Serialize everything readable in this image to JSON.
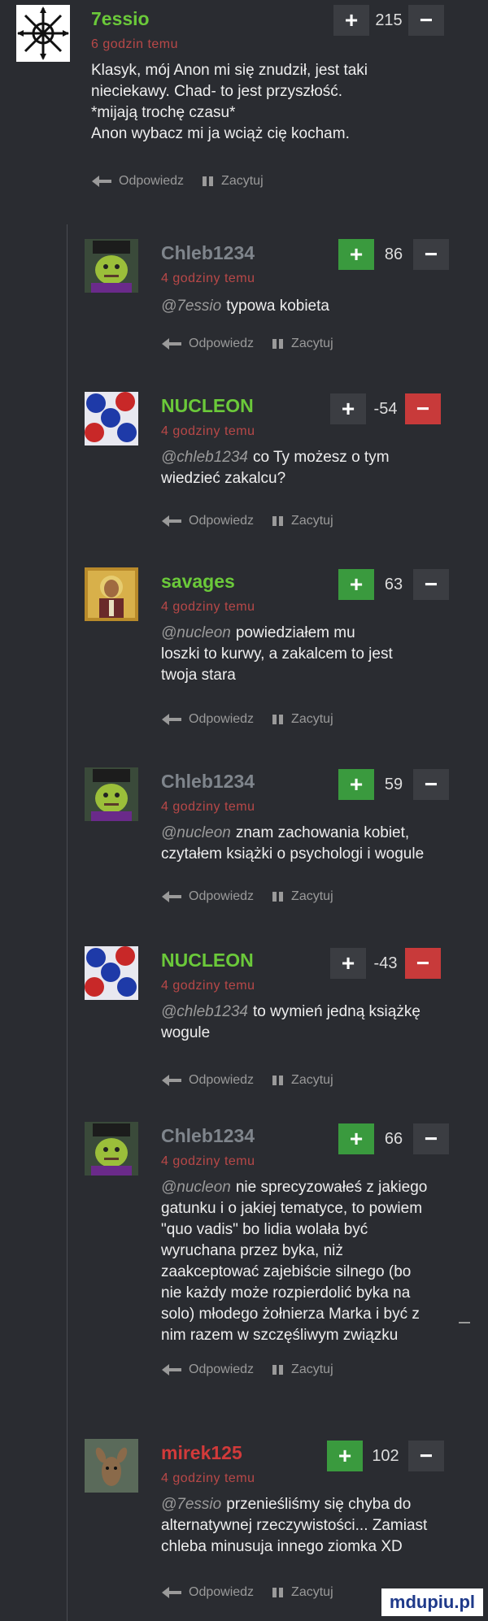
{
  "colors": {
    "background": "#2a2c31",
    "username": "#6bc93a",
    "time": "#b84848",
    "upvote_active": "#3a9a3e",
    "downvote_active": "#c83a3a"
  },
  "actions": {
    "reply": "Odpowiedz",
    "quote": "Zacytuj"
  },
  "comments": [
    {
      "user": "7essio",
      "time": "6 godzin temu",
      "score": "215",
      "upvote_active": false,
      "downvote_active": false,
      "avatar": "occult-star-symbol",
      "lines": [
        "Klasyk, mój Anon mi się znudził, jest taki",
        "nieciekawy. Chad- to jest przyszłość.",
        "*mijają trochę czasu*",
        "Anon wybacz mi ja wciąż cię kocham."
      ]
    },
    {
      "user": "Chleb1234",
      "time": "4 godziny temu",
      "score": "86",
      "upvote_active": true,
      "downvote_active": false,
      "avatar": "shrek-soldier",
      "mention": "@7essio",
      "lines": [
        "typowa kobieta"
      ]
    },
    {
      "user": "NUCLEON",
      "time": "4 godziny temu",
      "score": "-54",
      "upvote_active": false,
      "downvote_active": true,
      "avatar": "molecule-model",
      "mention": "@chleb1234",
      "lines": [
        "co Ty możesz o tym",
        "wiedzieć zakalcu?"
      ]
    },
    {
      "user": "savages",
      "time": "4 godziny temu",
      "score": "63",
      "upvote_active": true,
      "downvote_active": false,
      "avatar": "religious-icon",
      "mention": "@nucleon",
      "lines": [
        "powiedziałem mu",
        "loszki to kurwy, a zakalcem to jest",
        "twoja stara"
      ]
    },
    {
      "user": "Chleb1234",
      "time": "4 godziny temu",
      "score": "59",
      "upvote_active": true,
      "downvote_active": false,
      "avatar": "shrek-soldier",
      "mention": "@nucleon",
      "lines": [
        "znam zachowania kobiet,",
        "czytałem książki o psychologi i wogule"
      ]
    },
    {
      "user": "NUCLEON",
      "time": "4 godziny temu",
      "score": "-43",
      "upvote_active": false,
      "downvote_active": true,
      "avatar": "molecule-model",
      "mention": "@chleb1234",
      "lines": [
        "to wymień jedną książkę",
        "wogule"
      ]
    },
    {
      "user": "Chleb1234",
      "time": "4 godziny temu",
      "score": "66",
      "upvote_active": true,
      "downvote_active": false,
      "avatar": "shrek-soldier",
      "mention": "@nucleon",
      "lines": [
        "nie sprecyzowałeś z jakiego",
        "gatunku i o jakiej tematyce, to powiem",
        "\"quo vadis\" bo lidia wolała być",
        "wyruchana przez byka, niż",
        "zaakceptować zajebiście silnego (bo",
        "nie każdy może rozpierdolić byka na",
        "solo) młodego żołnierza Marka i być z",
        "nim razem w szczęśliwym związku"
      ]
    },
    {
      "user": "mirek125",
      "time": "4 godziny temu",
      "score": "102",
      "upvote_active": true,
      "downvote_active": false,
      "avatar": "deer-photo",
      "mention": "@7essio",
      "lines": [
        "przenieśliśmy się chyba do",
        "alternatywnej rzeczywistości... Zamiast",
        "chleba minusuja innego ziomka XD"
      ]
    }
  ],
  "watermark": "mdupiu.pl"
}
